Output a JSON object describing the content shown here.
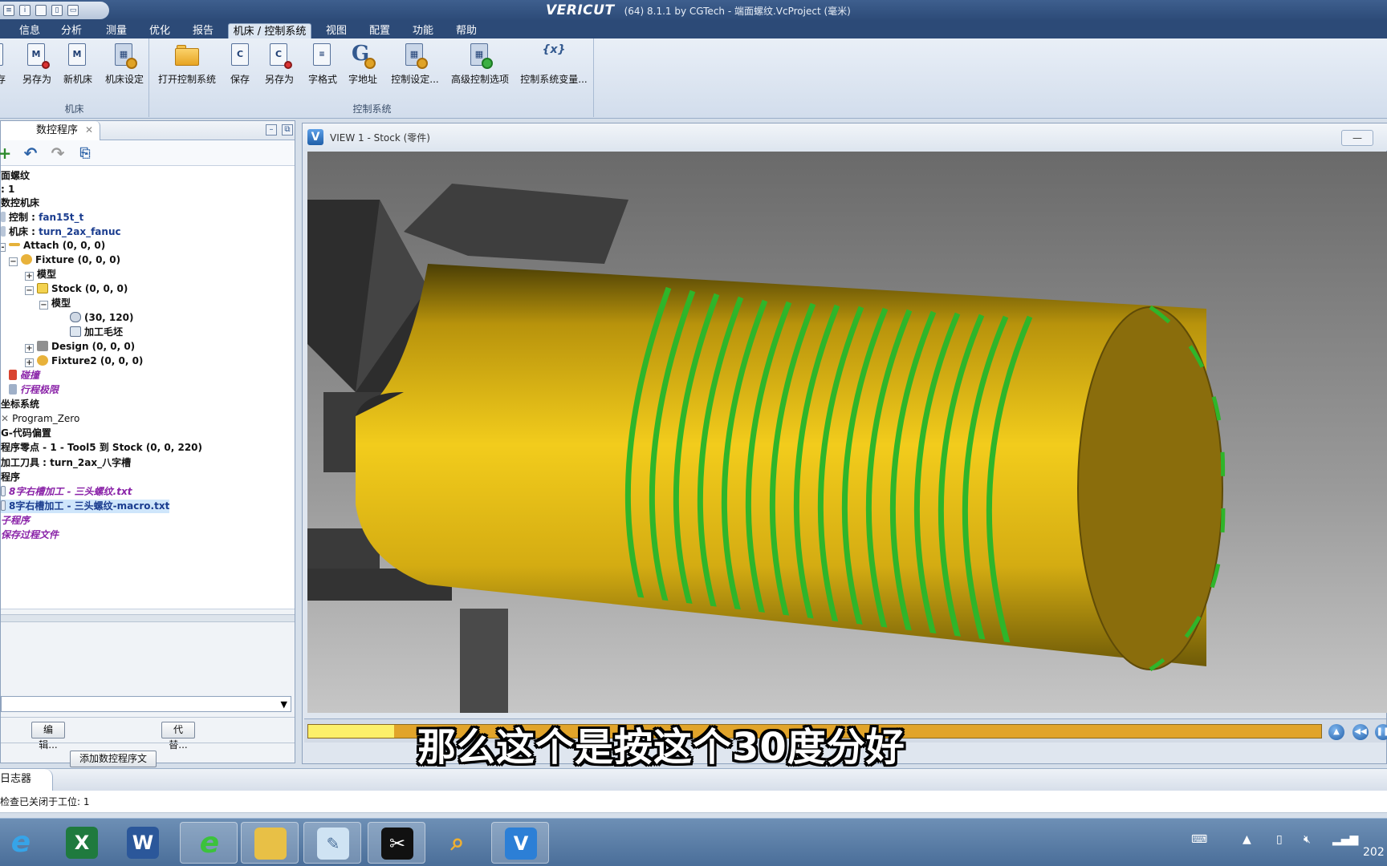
{
  "window": {
    "brand": "VERICUT",
    "title": "(64)  8.1.1 by CGTech - 端面螺纹.VcProject (毫米)"
  },
  "menu": {
    "tabs": [
      "信息",
      "分析",
      "测量",
      "优化",
      "报告",
      "机床 / 控制系统",
      "视图",
      "配置",
      "功能",
      "帮助"
    ],
    "active": "机床 / 控制系统"
  },
  "ribbon": {
    "machine_group": {
      "label": "机床",
      "buttons": [
        "存",
        "另存为",
        "新机床",
        "机床设定"
      ]
    },
    "control_group": {
      "label": "控制系统",
      "buttons": [
        "打开控制系统",
        "保存",
        "另存为",
        "字格式",
        "字地址",
        "控制设定...",
        "高级控制选项",
        "控制系统变量..."
      ]
    }
  },
  "left_panel": {
    "tab_label": "数控程序",
    "tree": [
      {
        "text": "面螺纹",
        "style": "bold"
      },
      {
        "text": ": 1",
        "style": "bold"
      },
      {
        "text": "数控机床",
        "style": "bold"
      },
      {
        "prefix": "控制 : ",
        "text": "fan15t_t",
        "style": "bold"
      },
      {
        "prefix": "机床 : ",
        "text": "turn_2ax_fanuc",
        "style": "bold"
      },
      {
        "text": "Attach (0, 0, 0)",
        "style": "bold"
      },
      {
        "text": "Fixture (0, 0, 0)",
        "style": "bold"
      },
      {
        "text": "模型",
        "style": "bold"
      },
      {
        "text": "Stock (0, 0, 0)",
        "style": "bold"
      },
      {
        "text": "模型",
        "style": "bold"
      },
      {
        "text": "(30, 120)",
        "style": "bold"
      },
      {
        "text": "加工毛坯",
        "style": "bold"
      },
      {
        "text": "Design (0, 0, 0)",
        "style": "bold"
      },
      {
        "text": "Fixture2 (0, 0, 0)",
        "style": "bold"
      },
      {
        "text": "碰撞",
        "style": "purple"
      },
      {
        "text": "行程极限",
        "style": "purple"
      },
      {
        "text": "坐标系统",
        "style": "bold"
      },
      {
        "text": "Program_Zero",
        "style": "normal"
      },
      {
        "text": "G-代码偏置",
        "style": "bold"
      },
      {
        "text": "程序零点 - 1 - Tool5 到 Stock (0, 0, 220)",
        "style": "bold"
      },
      {
        "text": "加工刀具 : turn_2ax_八字槽",
        "style": "bold"
      },
      {
        "text": "程序",
        "style": "bold"
      },
      {
        "text": "8字右槽加工 - 三头螺纹.txt",
        "style": "purple"
      },
      {
        "text": "8字右槽加工 - 三头螺纹-macro.txt",
        "style": "selected"
      },
      {
        "text": "子程序",
        "style": "purple"
      },
      {
        "text": "保存过程文件",
        "style": "purple"
      }
    ],
    "edit_button": "编辑...",
    "replace_button": "代替...",
    "add_program_button": "添加数控程序文件"
  },
  "viewport": {
    "title": "VIEW 1 - Stock (零件)",
    "progress_fraction": 0.085
  },
  "subtitle": "那么这个是按这个30度分好",
  "log": {
    "tab_label": "日志器",
    "message": "检查已关闭于工位:  1"
  },
  "taskbar": {
    "apps": [
      "internet-explorer",
      "excel",
      "word",
      "browser",
      "file-explorer",
      "notepad",
      "capcut",
      "magnifier",
      "vericut"
    ],
    "clock": "202"
  },
  "colors": {
    "title_bar": "#2c4a77",
    "stock_yellow": "#e6be14",
    "thread_green": "#2fb52a",
    "background_gray": "#808080"
  }
}
